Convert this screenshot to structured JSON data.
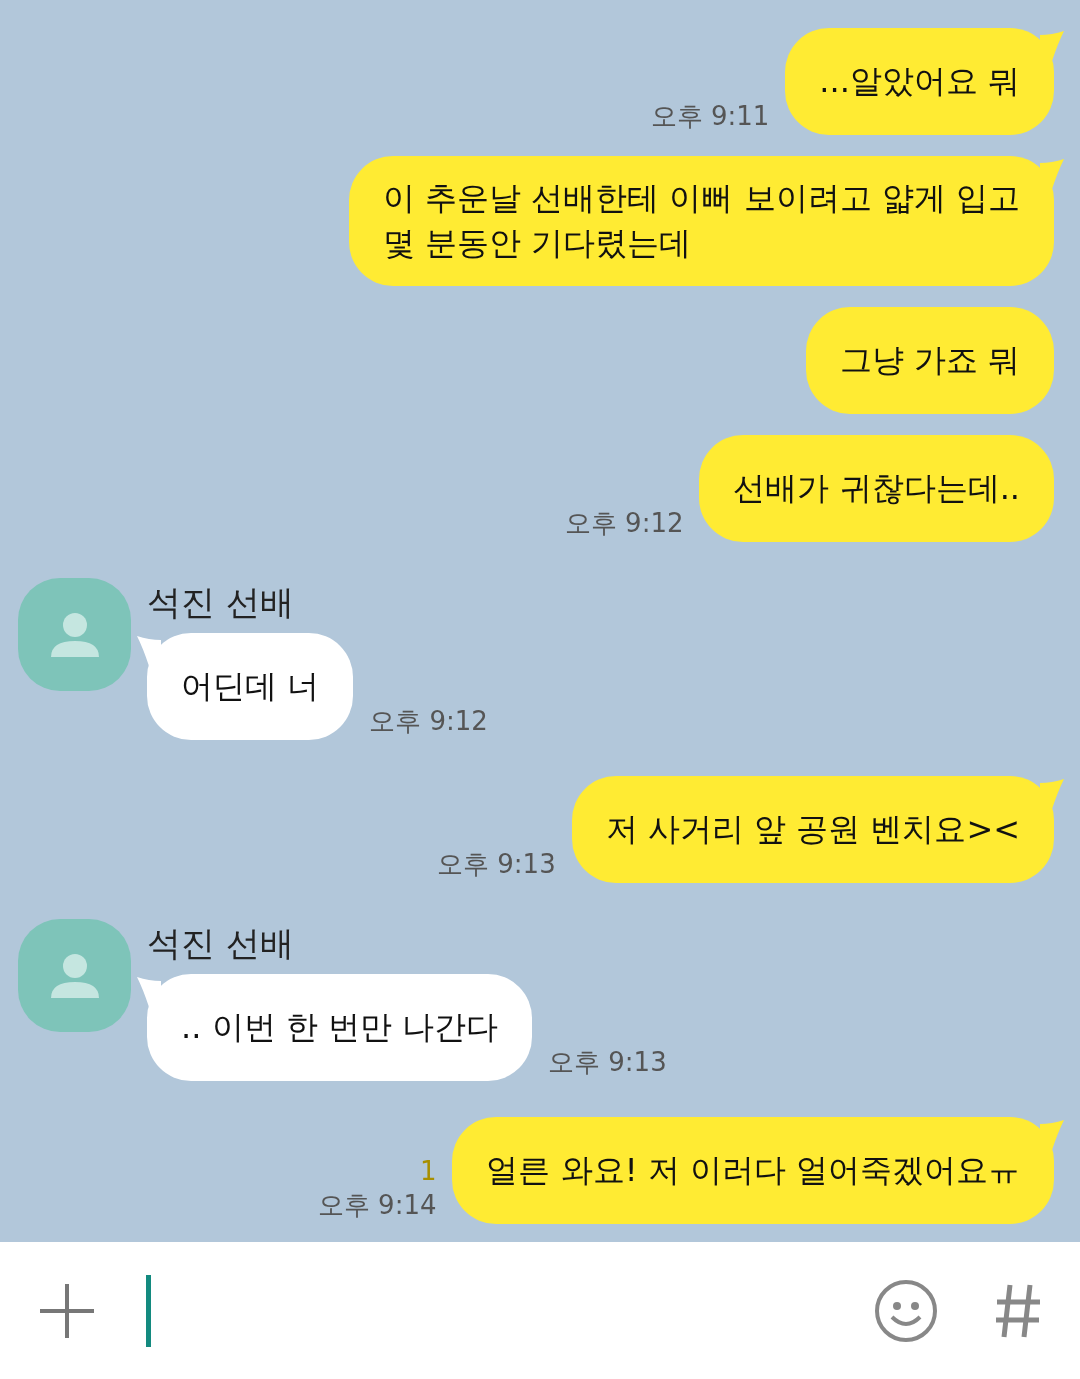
{
  "messages": [
    {
      "kind": "sent",
      "text": "...알았어요 뭐",
      "time": "오후 9:11",
      "tail": true
    },
    {
      "kind": "sent",
      "text": "이 추운날 선배한테 이뻐 보이려고 얇게 입고\n몇 분동안 기다렸는데",
      "tail": true
    },
    {
      "kind": "sent",
      "text": "그냥 가죠 뭐",
      "tail": false
    },
    {
      "kind": "sent",
      "text": "선배가 귀찮다는데..",
      "time": "오후 9:12",
      "tail": false
    },
    {
      "kind": "received",
      "sender": "석진 선배",
      "text": "어딘데 너",
      "time": "오후 9:12",
      "tail": true
    },
    {
      "kind": "sent",
      "text": "저 사거리 앞 공원 벤치요><",
      "time": "오후 9:13",
      "tail": true
    },
    {
      "kind": "received",
      "sender": "석진 선배",
      "text": ".. 이번 한 번만 나간다",
      "time": "오후 9:13",
      "tail": true
    },
    {
      "kind": "sent",
      "text": "얼른 와요! 저 이러다 얼어죽겠어요ㅠ",
      "time": "오후 9:14",
      "unread": "1",
      "tail": true
    }
  ]
}
